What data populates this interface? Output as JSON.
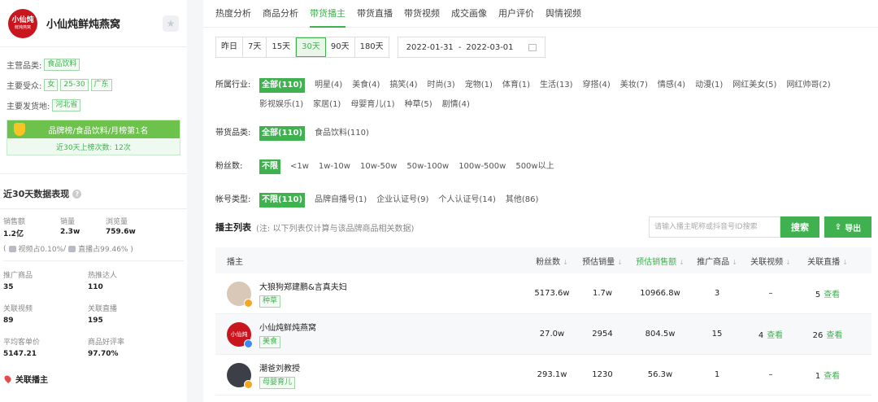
{
  "brand": {
    "logo_text": "小仙炖",
    "logo_sub": "鲜炖燕窝",
    "name": "小仙炖鲜炖燕窝",
    "star_icon": "star-icon"
  },
  "info": {
    "main_category_label": "主营品类:",
    "main_category": "食品饮料",
    "audience_label": "主要受众:",
    "audience_gender": "女",
    "audience_age": "25-30",
    "audience_region": "广东",
    "ship_label": "主要发货地:",
    "ship_from": "河北省"
  },
  "rank": {
    "title": "品牌榜/食品饮料/月榜第1名",
    "count": "近30天上榜次数: 12次"
  },
  "perf": {
    "title": "近30天数据表现",
    "sales_label": "销售额",
    "sales": "1.2亿",
    "volume_label": "销量",
    "volume": "2.3w",
    "views_label": "浏览量",
    "views": "759.6w",
    "share_open": "( ",
    "video_share": "视频占0.10%",
    "sep": " / ",
    "live_share": "直播占99.46% )",
    "promo_label": "推广商品",
    "promo": "35",
    "hot_label": "热推达人",
    "hot": "110",
    "video_label": "关联视频",
    "video": "89",
    "live_label": "关联直播",
    "live": "195",
    "aov_label": "平均客单价",
    "aov": "5147.21",
    "rating_label": "商品好评率",
    "rating": "97.70%"
  },
  "bottom_link": "关联播主",
  "tabs": [
    "热度分析",
    "商品分析",
    "带货播主",
    "带货直播",
    "带货视频",
    "成交画像",
    "用户评价",
    "舆情视频"
  ],
  "active_tab": "带货播主",
  "date_buttons": [
    "昨日",
    "7天",
    "15天",
    "30天",
    "90天",
    "180天"
  ],
  "date_active": "30天",
  "date_start": "2022-01-31",
  "date_sep": "-",
  "date_end": "2022-03-01",
  "industry": {
    "label": "所属行业:",
    "options": [
      "全部(110)",
      "明星(4)",
      "美食(4)",
      "搞笑(4)",
      "时尚(3)",
      "宠物(1)",
      "体育(1)",
      "生活(13)",
      "穿搭(4)",
      "美妆(7)",
      "情感(4)",
      "动漫(1)",
      "网红美女(5)",
      "网红帅哥(2)",
      "影视娱乐(1)",
      "家居(1)",
      "母婴育儿(1)",
      "种草(5)",
      "剧情(4)"
    ]
  },
  "category": {
    "label": "带货品类:",
    "options": [
      "全部(110)",
      "食品饮料(110)"
    ]
  },
  "fans": {
    "label": "粉丝数:",
    "options": [
      "不限",
      "<1w",
      "1w-10w",
      "10w-50w",
      "50w-100w",
      "100w-500w",
      "500w以上"
    ]
  },
  "account": {
    "label": "帐号类型:",
    "options": [
      "不限(110)",
      "品牌自播号(1)",
      "企业认证号(9)",
      "个人认证号(14)",
      "其他(86)"
    ]
  },
  "list": {
    "title": "播主列表",
    "note": "(注: 以下列表仅计算与该品牌商品相关数据)",
    "search_placeholder": "请输入播主昵称或抖音号ID搜索",
    "search_btn": "搜索",
    "export_btn": "导出"
  },
  "columns": [
    "播主",
    "粉丝数",
    "预估销量",
    "预估销售额",
    "推广商品",
    "关联视频",
    "关联直播"
  ],
  "view_link": "查看",
  "rows": [
    {
      "name": "大狼狗郑建鹏&言真夫妇",
      "tag": "种草",
      "fans": "5173.6w",
      "volume": "1.7w",
      "sales": "10966.8w",
      "products": "3",
      "videos": "–",
      "lives": "5"
    },
    {
      "name": "小仙炖鲜炖燕窝",
      "tag": "美食",
      "fans": "27.0w",
      "volume": "2954",
      "sales": "804.5w",
      "products": "15",
      "videos": "4",
      "lives": "26"
    },
    {
      "name": "潮爸刘教授",
      "tag": "母婴育儿",
      "fans": "293.1w",
      "volume": "1230",
      "sales": "56.3w",
      "products": "1",
      "videos": "–",
      "lives": "1"
    }
  ]
}
